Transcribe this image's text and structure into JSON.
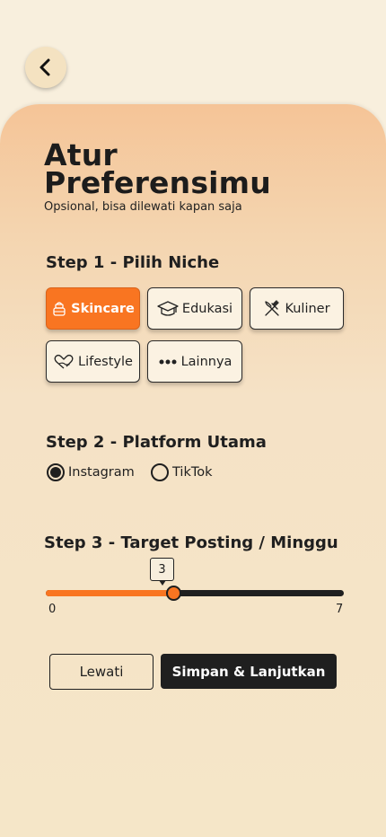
{
  "header": {
    "back_icon": "chevron-left-icon"
  },
  "intro": {
    "title": "Atur\nPreferensimu",
    "subtitle": "Opsional, bisa dilewati kapan saja"
  },
  "step1": {
    "title": "Step 1 - Pilih Niche",
    "selected": "Skincare",
    "options": [
      {
        "label": "Skincare",
        "icon": "skincare-jar-icon"
      },
      {
        "label": "Edukasi",
        "icon": "graduation-cap-icon"
      },
      {
        "label": "Kuliner",
        "icon": "utensils-icon"
      },
      {
        "label": "Lifestyle",
        "icon": "heart-hand-icon"
      },
      {
        "label": "Lainnya",
        "icon": "more-dots-icon"
      }
    ]
  },
  "step2": {
    "title": "Step 2 - Platform Utama",
    "selected": "Instagram",
    "options": [
      {
        "label": "Instagram"
      },
      {
        "label": "TikTok"
      }
    ]
  },
  "step3": {
    "title": "Step 3 - Target Posting / Minggu",
    "value": 3,
    "value_text": "3",
    "min": 0,
    "max": 7,
    "min_label": "0",
    "max_label": "7"
  },
  "actions": {
    "skip_label": "Lewati",
    "save_label": "Simpan & Lanjutkan"
  },
  "colors": {
    "accent": "#f97521",
    "dark": "#1f1f1f",
    "background": "#f8efdd",
    "card_top": "#f5c497"
  }
}
